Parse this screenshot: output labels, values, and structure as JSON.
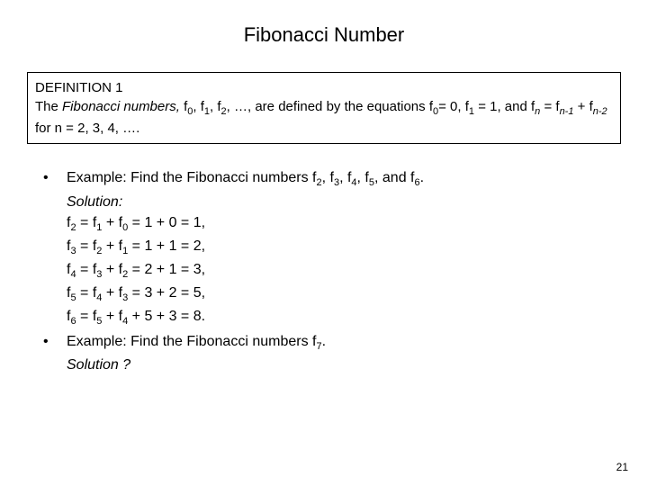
{
  "title": "Fibonacci Number",
  "definition": {
    "label": "DEFINITION 1",
    "line1_a": "The ",
    "line1_b": "Fibonacci numbers,",
    "line1_c": " f",
    "line1_s0": "0",
    "line1_d": ", f",
    "line1_s1": "1",
    "line1_e": ", f",
    "line1_s2": "2",
    "line1_f": ", …, are defined by the equations f",
    "line1_s0b": "0",
    "line1_g": "= 0, f",
    "line1_s1b": "1",
    "line1_h": " = 1, and f",
    "line1_sn": "n",
    "line1_i": " = f",
    "line1_sn1": "n-1",
    "line1_j": " + f",
    "line1_sn2": "n-2",
    "line2": "for n = 2, 3, 4, …."
  },
  "example1": {
    "prompt_a": "Example: Find the Fibonacci numbers f",
    "s2": "2",
    "sep1": ", f",
    "s3": "3",
    "sep2": ", f",
    "s4": "4",
    "sep3": ", f",
    "s5": "5",
    "sep4": ", and f",
    "s6": "6",
    "end": ".",
    "solution_label": "Solution:",
    "l1_a": "f",
    "l1_s": "2",
    "l1_b": " = f",
    "l1_s1": "1",
    "l1_c": " + f",
    "l1_s0": "0",
    "l1_d": " = 1 + 0 = 1,",
    "l2_a": "f",
    "l2_s": "3",
    "l2_b": " = f",
    "l2_s1": "2",
    "l2_c": " + f",
    "l2_s0": "1",
    "l2_d": " = 1 + 1 = 2,",
    "l3_a": "f",
    "l3_s": "4",
    "l3_b": " = f",
    "l3_s1": "3",
    "l3_c": " + f",
    "l3_s0": "2",
    "l3_d": " = 2 + 1 = 3,",
    "l4_a": "f",
    "l4_s": "5",
    "l4_b": " = f",
    "l4_s1": "4",
    "l4_c": " + f",
    "l4_s0": "3",
    "l4_d": " = 3 + 2 = 5,",
    "l5_a": "f",
    "l5_s": "6",
    "l5_b": " = f",
    "l5_s1": "5",
    "l5_c": " + f",
    "l5_s0": "4",
    "l5_d": " + 5 + 3 = 8."
  },
  "example2": {
    "prompt_a": "Example: Find the Fibonacci numbers f",
    "s7": "7",
    "end": ".",
    "solution_label": "Solution ?"
  },
  "page_number": "21"
}
